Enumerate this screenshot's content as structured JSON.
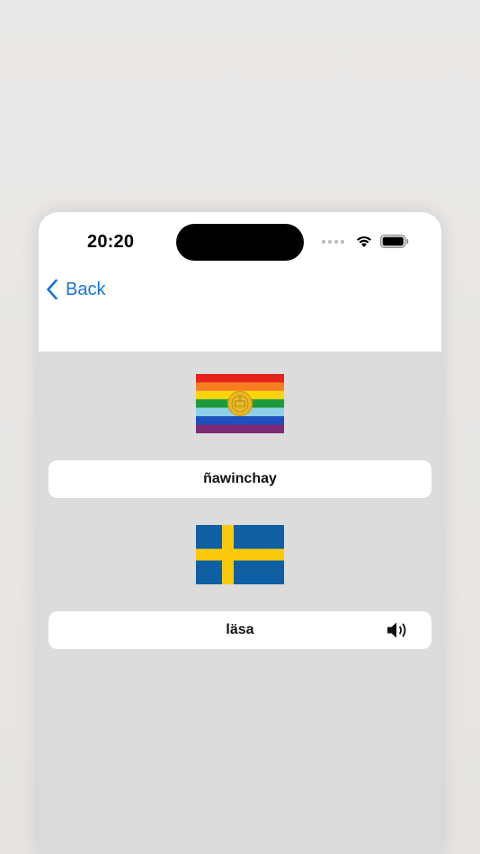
{
  "status_bar": {
    "time": "20:20"
  },
  "nav": {
    "back_label": "Back"
  },
  "source": {
    "word": "ñawinchay",
    "flag": "wiphala-flag"
  },
  "target": {
    "word": "läsa",
    "flag": "sweden-flag",
    "audio_icon": "speaker-icon"
  },
  "colors": {
    "accent": "#1a73d9",
    "content_bg": "#dcdcdc",
    "card_bg": "#ffffff"
  }
}
